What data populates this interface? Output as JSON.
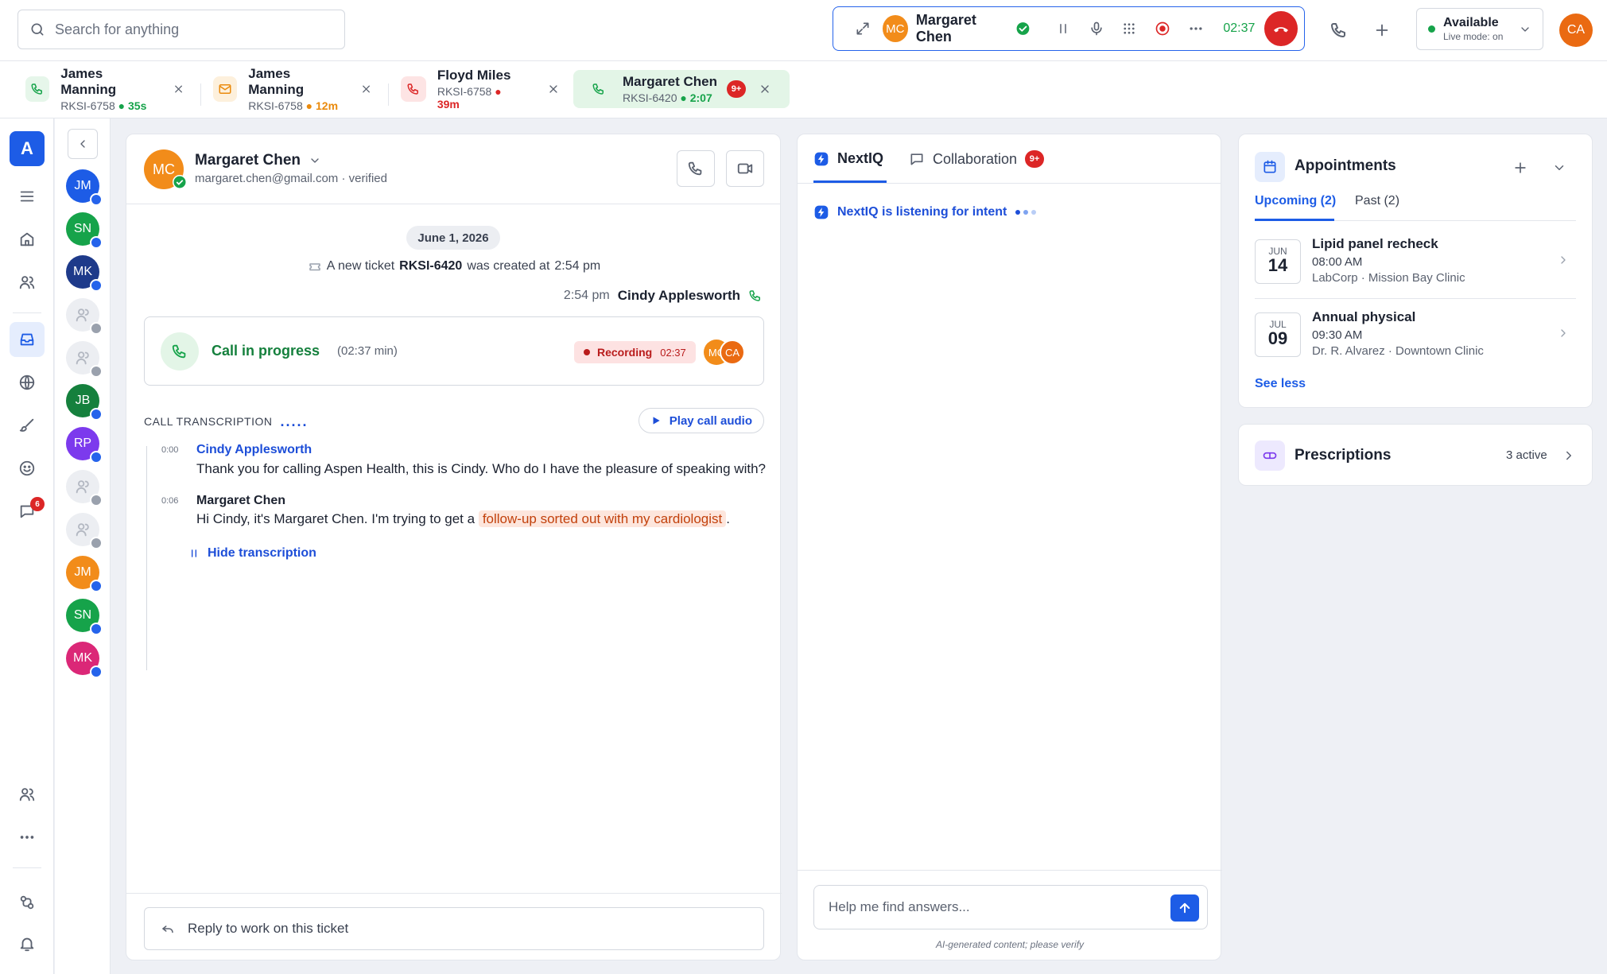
{
  "search": {
    "placeholder": "Search for anything"
  },
  "active_call": {
    "initials": "MC",
    "name": "Margaret Chen",
    "timer": "02:37"
  },
  "status": {
    "label": "Available",
    "sub": "Live mode: on"
  },
  "user": {
    "initials": "CA"
  },
  "session_tabs": [
    {
      "name": "James Manning",
      "ticket": "RKSI-6758",
      "time": "35s",
      "kind": "phone",
      "color": "#16a34a"
    },
    {
      "name": "James Manning",
      "ticket": "RKSI-6758",
      "time": "12m",
      "kind": "email",
      "color": "#ea8a0c"
    },
    {
      "name": "Floyd Miles",
      "ticket": "RKSI-6758",
      "time": "39m",
      "kind": "phone",
      "color": "#dc2626"
    },
    {
      "name": "Margaret Chen",
      "ticket": "RKSI-6420",
      "time": "2:07",
      "kind": "phone",
      "color": "#16a34a",
      "badge": "9+"
    }
  ],
  "rail": {
    "logo": "A",
    "chat_badge": "6"
  },
  "avatars": [
    {
      "initials": "JM",
      "color": "#1d5ce6"
    },
    {
      "initials": "SN",
      "color": "#16a34a"
    },
    {
      "initials": "MK",
      "color": "#1e3a8a"
    },
    {
      "initials": "",
      "color": ""
    },
    {
      "initials": "",
      "color": ""
    },
    {
      "initials": "JB",
      "color": "#15803d"
    },
    {
      "initials": "RP",
      "color": "#7c3aed"
    },
    {
      "initials": "",
      "color": ""
    },
    {
      "initials": "",
      "color": ""
    },
    {
      "initials": "JM",
      "color": "#f28c1a"
    },
    {
      "initials": "SN",
      "color": "#16a34a"
    },
    {
      "initials": "MK",
      "color": "#db2777"
    }
  ],
  "conversation": {
    "contact_initials": "MC",
    "contact_name": "Margaret Chen",
    "contact_email": "margaret.chen@gmail.com · verified",
    "date": "June 1, 2026",
    "ticket_prefix": "A new ticket",
    "ticket_id": "RKSI-6420",
    "ticket_suffix": "was created at",
    "ticket_time": "2:54 pm",
    "msg_time": "2:54 pm",
    "agent": "Cindy Applesworth",
    "call_title": "Call in progress",
    "call_duration": "(02:37 min)",
    "recording_label": "Recording",
    "recording_time": "02:37",
    "participants": [
      "MC",
      "CA"
    ],
    "transcription_label": "CALL TRANSCRIPTION",
    "transcription_dots": ".....",
    "play_label": "Play call audio",
    "transcript": [
      {
        "t": "0:00",
        "speaker": "Cindy Applesworth",
        "text": "Thank you for calling Aspen Health, this is Cindy. Who do I have the pleasure of speaking with?"
      },
      {
        "t": "0:06",
        "speaker": "Margaret Chen",
        "text_pre": "Hi Cindy, it's Margaret Chen. I'm trying to get a",
        "highlight": "follow-up sorted out with my cardiologist",
        "text_post": "."
      }
    ],
    "hide_label": "Hide transcription",
    "reply_label": "Reply to work on this ticket"
  },
  "nextiq": {
    "tab1": "NextIQ",
    "tab2": "Collaboration",
    "tab2_badge": "9+",
    "listening": "NextIQ is listening for intent",
    "ask_placeholder": "Help me find answers...",
    "disclaimer": "AI-generated content; please verify"
  },
  "appointments": {
    "title": "Appointments",
    "tab_upcoming": "Upcoming (2)",
    "tab_past": "Past (2)",
    "items": [
      {
        "month": "JUN",
        "day": "14",
        "title": "Lipid panel recheck",
        "time": "08:00 AM",
        "location": "LabCorp · Mission Bay Clinic"
      },
      {
        "month": "JUL",
        "day": "09",
        "title": "Annual physical",
        "time": "09:30 AM",
        "location": "Dr. R. Alvarez · Downtown Clinic"
      }
    ],
    "see_less": "See less"
  },
  "prescriptions": {
    "title": "Prescriptions",
    "count": "3 active"
  }
}
